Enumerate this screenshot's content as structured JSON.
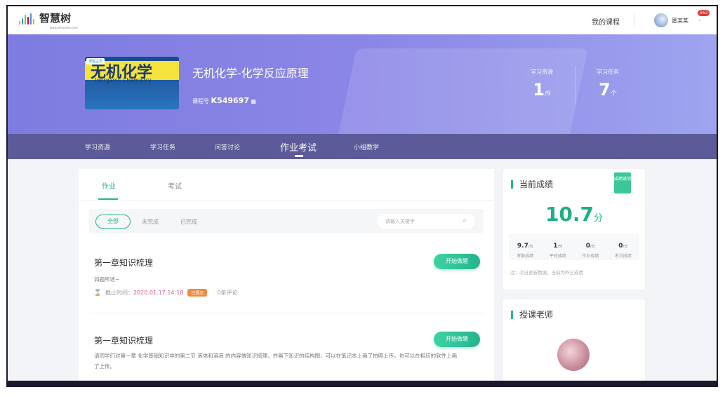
{
  "header": {
    "logo_text": "智慧树",
    "logo_url_text": "www.zhihuishu.com",
    "my_courses": "我的课程",
    "username": "匿某某",
    "notification_count": "562"
  },
  "course": {
    "cover_title": "无机化学",
    "cover_subtitle": "Inorganic Chemistry",
    "cover_home": "课程主页",
    "title": "无机化学-化学反应原理",
    "id_label": "课程号",
    "id_value": "K549697",
    "stats": [
      {
        "label": "学习资源",
        "value": "1",
        "unit": "/9"
      },
      {
        "label": "学习任务",
        "value": "7",
        "unit": "个"
      }
    ]
  },
  "nav": {
    "items": [
      "学习资源",
      "学习任务",
      "问答讨论",
      "作业考试",
      "小组教学"
    ],
    "active": 3
  },
  "main": {
    "tabs": [
      "作业",
      "考试"
    ],
    "filters": [
      "全部",
      "未完成",
      "已完成"
    ],
    "search_placeholder": "请输入关键字",
    "assignments": [
      {
        "title": "第一章知识梳理",
        "desc": "如题所述~",
        "deadline_label": "截止时间：",
        "deadline": "2020.01.17 14:18",
        "status": "已提交",
        "comments": "0条评论",
        "button": "开始做题"
      },
      {
        "title": "第一章知识梳理",
        "desc": "请同学们对第一章 化学基础知识中的第二节 液体和溶液 的内容做知识梳理，并画下知识的结构图，可以在笔记本上画了拍照上传，也可以在相应的软件上画了上传。",
        "button": "开始做题"
      }
    ]
  },
  "grades": {
    "title": "当前成绩",
    "sticker": "成绩说明",
    "total": "10.7",
    "total_unit": "分",
    "items": [
      {
        "value": "9.7",
        "unit": "/分",
        "label": "考勤成绩"
      },
      {
        "value": "1",
        "unit": "/分",
        "label": "平时成绩"
      },
      {
        "value": "0",
        "unit": "/分",
        "label": "作业成绩"
      },
      {
        "value": "0",
        "unit": "/分",
        "label": "考试成绩"
      }
    ],
    "note": "注：次日更新数据，当前为昨日成绩"
  },
  "teacher": {
    "title": "授课老师"
  },
  "colors": {
    "accent": "#26b48e",
    "banner": "#8b86e6",
    "nav": "#5c5a98",
    "tag": "#f08a3e"
  }
}
